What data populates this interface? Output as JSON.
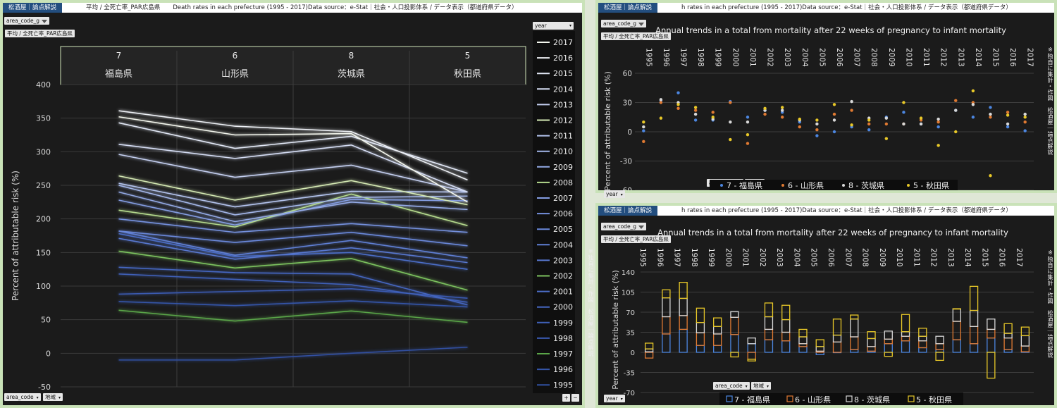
{
  "brand": "松酒屋｜論点解説",
  "left_panel": {
    "title_parts": [
      "平均 / 全死亡率_PAR広島県",
      "Death rates in each prefecture (1995 - 2017)Data source：e-Stat｜社会・人口投影体系 / データ表示（都道府県データ）"
    ],
    "filter_label": "area_code_g",
    "pill_label": "平均 / 全死亡率_PAR広島県",
    "area_code_btn": "area_code",
    "region_btn": "地域",
    "year_filter_label": "year",
    "zoom_plus": "+",
    "zoom_minus": "−"
  },
  "right_top": {
    "title": "h rates in each prefecture (1995 - 2017)Data source：e-Stat｜社会・人口投影体系 / データ表示（都道府県データ）",
    "filter_label": "area_code_g",
    "pill_label": "平均 / 全死亡率_PAR広島県",
    "area_code_btn": "area_code",
    "region_btn": "地域",
    "year_btn": "year",
    "side_note": "※独自に集計・作図　松酒屋｜論点解説"
  },
  "right_bottom": {
    "title": "h rates in each prefecture (1995 - 2017)Data source：e-Stat｜社会・人口投影体系 / データ表示（都道府県データ）",
    "filter_label": "area_code_g",
    "pill_label": "平均 / 全死亡率_PAR広島県",
    "area_code_btn": "area_code",
    "region_btn": "地域",
    "year_btn": "year",
    "side_note": "※独自に集計・作図　松酒屋｜論点解説",
    "left_note": "※独自に集計・作図　松酒屋｜論点解説"
  },
  "chart_data": [
    {
      "type": "line",
      "ylabel": "Percent of attributable risk (%)",
      "ylim": [
        -50,
        400
      ],
      "yticks": [
        -50,
        0,
        50,
        100,
        150,
        200,
        250,
        300,
        350,
        400
      ],
      "grid": true,
      "legend_position": "right",
      "categories": [
        {
          "code": "7",
          "name": "福島県"
        },
        {
          "code": "6",
          "name": "山形県"
        },
        {
          "code": "8",
          "name": "茨城県"
        },
        {
          "code": "5",
          "name": "秋田県"
        }
      ],
      "series": [
        {
          "name": "2017",
          "color": "#f4f7ee",
          "values": [
            352,
            325,
            327,
            225
          ]
        },
        {
          "name": "2016",
          "color": "#eef1f6",
          "values": [
            361,
            338,
            330,
            258
          ]
        },
        {
          "name": "2015",
          "color": "#e2e8f6",
          "values": [
            343,
            305,
            323,
            268
          ]
        },
        {
          "name": "2014",
          "color": "#d5ddf4",
          "values": [
            311,
            290,
            310,
            240
          ]
        },
        {
          "name": "2013",
          "color": "#c4cff0",
          "values": [
            296,
            262,
            280,
            240
          ]
        },
        {
          "name": "2012",
          "color": "#d5eab4",
          "values": [
            264,
            228,
            257,
            221
          ]
        },
        {
          "name": "2011",
          "color": "#b4c4ee",
          "values": [
            253,
            218,
            241,
            240
          ]
        },
        {
          "name": "2010",
          "color": "#a4b7ea",
          "values": [
            250,
            206,
            232,
            234
          ]
        },
        {
          "name": "2009",
          "color": "#94aae6",
          "values": [
            240,
            196,
            225,
            214
          ]
        },
        {
          "name": "2008",
          "color": "#b5db8e",
          "values": [
            213,
            188,
            237,
            190
          ]
        },
        {
          "name": "2007",
          "color": "#849de2",
          "values": [
            228,
            191,
            229,
            227
          ]
        },
        {
          "name": "2006",
          "color": "#7591de",
          "values": [
            200,
            180,
            193,
            180
          ]
        },
        {
          "name": "2005",
          "color": "#6a88da",
          "values": [
            182,
            165,
            180,
            160
          ]
        },
        {
          "name": "2004",
          "color": "#6080d6",
          "values": [
            182,
            146,
            168,
            142
          ]
        },
        {
          "name": "2003",
          "color": "#5878d0",
          "values": [
            171,
            140,
            157,
            135
          ]
        },
        {
          "name": "2002",
          "color": "#7cc25e",
          "values": [
            152,
            127,
            141,
            94
          ]
        },
        {
          "name": "2001",
          "color": "#4c6ec8",
          "values": [
            178,
            144,
            150,
            125
          ]
        },
        {
          "name": "2000",
          "color": "#4566c0",
          "values": [
            128,
            120,
            118,
            72
          ]
        },
        {
          "name": "1999",
          "color": "#3f60b8",
          "values": [
            118,
            110,
            102,
            76
          ]
        },
        {
          "name": "1998",
          "color": "#3a5ab0",
          "values": [
            88,
            92,
            96,
            82
          ]
        },
        {
          "name": "1997",
          "color": "#5aa548",
          "values": [
            64,
            48,
            63,
            46
          ]
        },
        {
          "name": "1996",
          "color": "#3555a8",
          "values": [
            77,
            71,
            78,
            69
          ]
        },
        {
          "name": "1995",
          "color": "#3050a0",
          "values": [
            -10,
            -10,
            0,
            9
          ]
        }
      ]
    },
    {
      "type": "scatter",
      "title": "Annual trends in a total from mortality after 22 weeks of pregnancy to infant mortality",
      "ylabel": "Percent of attributable risk (%)",
      "ylim": [
        -60,
        60
      ],
      "yticks": [
        -60,
        -30,
        0,
        30,
        60
      ],
      "grid": true,
      "legend_position": "bottom",
      "x": [
        "1995",
        "1996",
        "1997",
        "1998",
        "1999",
        "2000",
        "2001",
        "2002",
        "2003",
        "2004",
        "2005",
        "2006",
        "2007",
        "2008",
        "2009",
        "2010",
        "2011",
        "2012",
        "2013",
        "2014",
        "2015",
        "2016",
        "2017"
      ],
      "series": [
        {
          "name": "7 - 福島県",
          "color": "#4c86e0",
          "values": [
            1,
            32,
            40,
            12,
            12,
            31,
            15,
            22,
            20,
            10,
            -4,
            0,
            5,
            2,
            15,
            20,
            8,
            5,
            22,
            15,
            25,
            5,
            1
          ]
        },
        {
          "name": "6 - 山形県",
          "color": "#e07a32",
          "values": [
            -10,
            30,
            24,
            22,
            20,
            30,
            -12,
            18,
            15,
            5,
            2,
            18,
            22,
            8,
            8,
            8,
            12,
            10,
            32,
            30,
            15,
            20,
            10
          ]
        },
        {
          "name": "8 - 茨城県",
          "color": "#d8d8d8",
          "values": [
            5,
            33,
            30,
            18,
            13,
            10,
            10,
            22,
            22,
            12,
            8,
            12,
            31,
            14,
            14,
            8,
            8,
            13,
            22,
            28,
            18,
            8,
            18
          ]
        },
        {
          "name": "5 - 秋田県",
          "color": "#e8c828",
          "values": [
            10,
            14,
            28,
            25,
            15,
            -8,
            -3,
            24,
            25,
            13,
            12,
            28,
            7,
            12,
            -7,
            30,
            14,
            -14,
            0,
            42,
            -45,
            17,
            15
          ]
        }
      ]
    },
    {
      "type": "bar",
      "stacked": true,
      "title": "Annual trends in a total from mortality after 22 weeks of pregnancy to infant mortality",
      "ylabel": "Percent of attributable risk (%)",
      "ylim": [
        -70,
        140
      ],
      "yticks": [
        -70,
        -35,
        0,
        35,
        70,
        105,
        140
      ],
      "grid": true,
      "legend_position": "bottom",
      "x": [
        "1995",
        "1996",
        "1997",
        "1998",
        "1999",
        "2000",
        "2001",
        "2002",
        "2003",
        "2004",
        "2005",
        "2006",
        "2007",
        "2008",
        "2009",
        "2010",
        "2011",
        "2012",
        "2013",
        "2014",
        "2015",
        "2016",
        "2017"
      ],
      "series": [
        {
          "name": "7 - 福島県",
          "color": "#4c86e0",
          "values": [
            1,
            32,
            40,
            12,
            12,
            31,
            15,
            22,
            20,
            10,
            -4,
            0,
            5,
            2,
            15,
            20,
            8,
            5,
            22,
            15,
            25,
            5,
            1
          ]
        },
        {
          "name": "6 - 山形県",
          "color": "#e07a32",
          "values": [
            -10,
            30,
            24,
            22,
            20,
            30,
            -12,
            18,
            15,
            5,
            2,
            18,
            22,
            8,
            8,
            8,
            12,
            10,
            32,
            30,
            15,
            20,
            10
          ]
        },
        {
          "name": "8 - 茨城県",
          "color": "#d8d8d8",
          "values": [
            5,
            33,
            30,
            18,
            13,
            10,
            10,
            22,
            22,
            12,
            8,
            12,
            31,
            14,
            14,
            8,
            8,
            13,
            22,
            28,
            18,
            8,
            18
          ]
        },
        {
          "name": "5 - 秋田県",
          "color": "#e8c828",
          "values": [
            10,
            14,
            28,
            25,
            15,
            -8,
            -3,
            24,
            25,
            13,
            12,
            28,
            7,
            12,
            -7,
            30,
            14,
            -14,
            0,
            42,
            -45,
            17,
            15
          ]
        }
      ]
    }
  ]
}
